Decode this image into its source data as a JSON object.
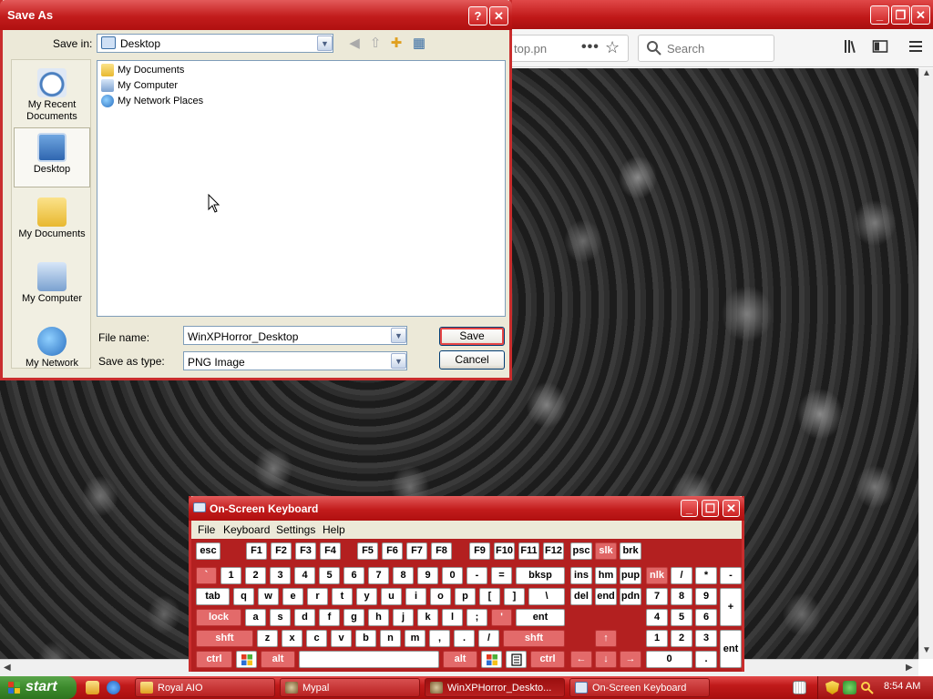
{
  "browser": {
    "url_text": "top.pn",
    "search_placeholder": "Search"
  },
  "save_dialog": {
    "title": "Save As",
    "help_button": "?",
    "close_button": "✕",
    "save_in_label": "Save in:",
    "save_in_value": "Desktop",
    "places": [
      "My Recent Documents",
      "Desktop",
      "My Documents",
      "My Computer",
      "My Network"
    ],
    "files": [
      "My Documents",
      "My Computer",
      "My Network Places"
    ],
    "file_name_label": "File name:",
    "file_name_value": "WinXPHorror_Desktop",
    "save_as_type_label": "Save as type:",
    "save_as_type_value": "PNG Image",
    "save_button": "Save",
    "cancel_button": "Cancel"
  },
  "osk": {
    "title": "On-Screen Keyboard",
    "menu": [
      "File",
      "Keyboard",
      "Settings",
      "Help"
    ],
    "keys": {
      "row1": [
        "esc",
        "F1",
        "F2",
        "F3",
        "F4",
        "F5",
        "F6",
        "F7",
        "F8",
        "F9",
        "F10",
        "F11",
        "F12",
        "psc",
        "slk",
        "brk"
      ],
      "row2": [
        "`",
        "1",
        "2",
        "3",
        "4",
        "5",
        "6",
        "7",
        "8",
        "9",
        "0",
        "-",
        "=",
        "bksp",
        "ins",
        "hm",
        "pup",
        "nlk",
        "/",
        "*",
        "-"
      ],
      "row3": [
        "tab",
        "q",
        "w",
        "e",
        "r",
        "t",
        "y",
        "u",
        "i",
        "o",
        "p",
        "[",
        "]",
        "\\",
        "del",
        "end",
        "pdn",
        "7",
        "8",
        "9",
        "+"
      ],
      "row4": [
        "lock",
        "a",
        "s",
        "d",
        "f",
        "g",
        "h",
        "j",
        "k",
        "l",
        ";",
        "'",
        "ent",
        "4",
        "5",
        "6"
      ],
      "row5": [
        "shft",
        "z",
        "x",
        "c",
        "v",
        "b",
        "n",
        "m",
        ",",
        ".",
        "/",
        "shft",
        "↑",
        "1",
        "2",
        "3",
        "ent"
      ],
      "row6": [
        "ctrl",
        "alt",
        "alt",
        "ctrl",
        "←",
        "↓",
        "→",
        "0",
        "."
      ]
    }
  },
  "taskbar": {
    "start_label": "start",
    "tasks": [
      "Royal AIO",
      "Mypal",
      "WinXPHorror_Deskto...",
      "On-Screen Keyboard"
    ],
    "clock": "8:54 AM"
  },
  "colors": {
    "theme_red": "#c21c1c",
    "start_green": "#3c8a2c",
    "dialog_face": "#ece9d8"
  }
}
